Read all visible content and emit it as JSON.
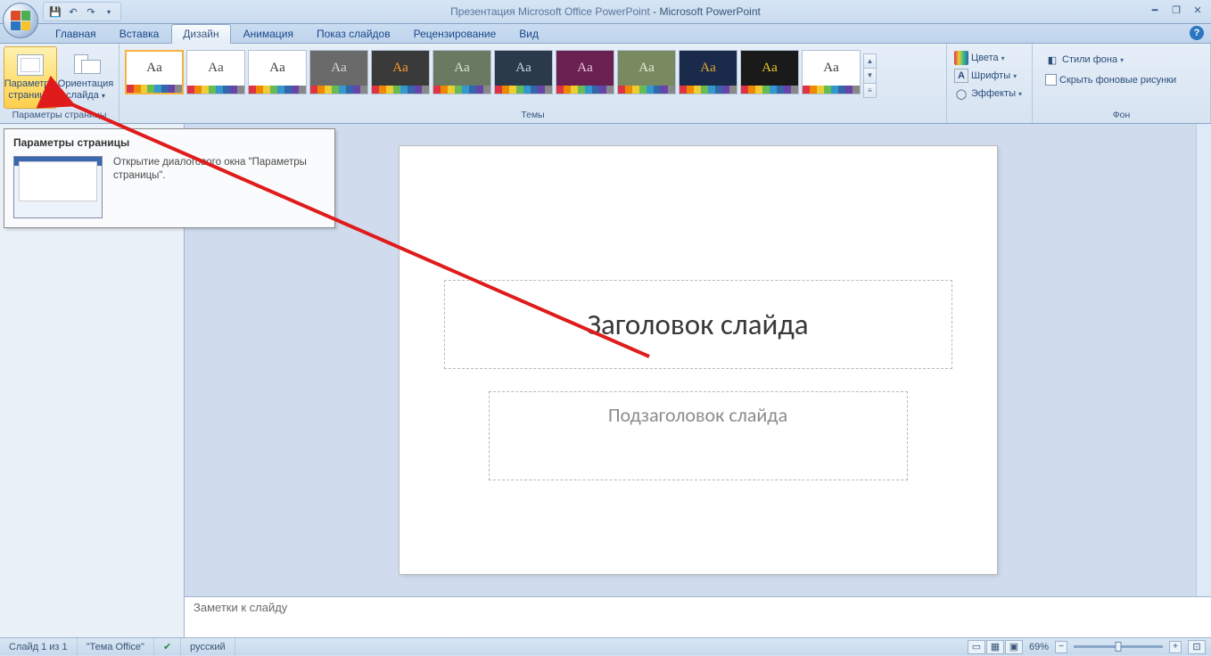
{
  "title": {
    "document": "Презентация Microsoft Office PowerPoint",
    "app": "Microsoft PowerPoint"
  },
  "tabs": {
    "home": "Главная",
    "insert": "Вставка",
    "design": "Дизайн",
    "animation": "Анимация",
    "slideshow": "Показ слайдов",
    "review": "Рецензирование",
    "view": "Вид"
  },
  "ribbon": {
    "page_setup": {
      "label": "Параметры страницы",
      "settings_btn_l1": "Параметры",
      "settings_btn_l2": "страницы",
      "orientation_btn_l1": "Ориентация",
      "orientation_btn_l2": "слайда"
    },
    "themes": {
      "label": "Темы",
      "sample": "Aa",
      "opts": {
        "colors": "Цвета",
        "fonts": "Шрифты",
        "effects": "Эффекты"
      }
    },
    "background": {
      "label": "Фон",
      "styles": "Стили фона",
      "hide_bg": "Скрыть фоновые рисунки"
    }
  },
  "tooltip": {
    "title": "Параметры страницы",
    "text": "Открытие диалогового окна \"Параметры страницы\"."
  },
  "slide": {
    "title_ph": "Заголовок слайда",
    "subtitle_ph": "Подзаголовок слайда"
  },
  "notes": {
    "placeholder": "Заметки к слайду"
  },
  "status": {
    "slide_of": "Слайд 1 из 1",
    "theme": "\"Тема Office\"",
    "lang": "русский",
    "zoom": "69%"
  },
  "theme_variants": [
    {
      "bg": "#ffffff",
      "fg": "#3a3a3a"
    },
    {
      "bg": "#ffffff",
      "fg": "#4a4a4a"
    },
    {
      "bg": "#ffffff",
      "fg": "#3a3a3a"
    },
    {
      "bg": "#6a6a6a",
      "fg": "#d8d8d8"
    },
    {
      "bg": "#3a3a3a",
      "fg": "#ff9a2a"
    },
    {
      "bg": "#6a7a62",
      "fg": "#d8e4d0"
    },
    {
      "bg": "#2a3a4a",
      "fg": "#cad8e4"
    },
    {
      "bg": "#6a2050",
      "fg": "#e8c8e0"
    },
    {
      "bg": "#7a8a60",
      "fg": "#e8eed6"
    },
    {
      "bg": "#1a2a4a",
      "fg": "#e8a82a"
    },
    {
      "bg": "#1a1a1a",
      "fg": "#e8c82a"
    },
    {
      "bg": "#ffffff",
      "fg": "#3a3a3a"
    }
  ]
}
